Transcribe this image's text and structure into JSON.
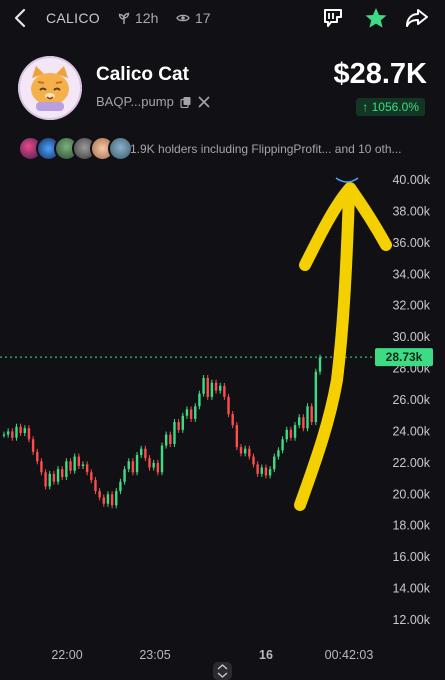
{
  "topbar": {
    "ticker": "CALICO",
    "age": "12h",
    "views": "17",
    "icons": [
      "back-chevron-icon",
      "sprout-icon",
      "eye-icon",
      "message-icon",
      "star-icon",
      "share-icon"
    ],
    "accent_star": "#3ddc84"
  },
  "token": {
    "name": "Calico Cat",
    "address": "BAQP...pump",
    "price": "$28.7K",
    "change": "↑ 1056.0%",
    "change_color": "#3ddc84"
  },
  "holders": {
    "text": "1.9K holders including FlippingProfit... and 10 oth..."
  },
  "chart_data": {
    "type": "line",
    "y_ticks": [
      "40.00k",
      "38.00k",
      "36.00k",
      "34.00k",
      "32.00k",
      "30.00k",
      "28.00k",
      "26.00k",
      "24.00k",
      "22.00k",
      "20.00k",
      "18.00k",
      "16.00k",
      "14.00k",
      "12.00k"
    ],
    "x_ticks": [
      "22:00",
      "23:05",
      "16",
      "00:42:03"
    ],
    "current_price_label": "28.73k",
    "current_price": 28.73,
    "ylim": [
      12,
      40
    ],
    "grid": false,
    "series": [
      {
        "values": [
          23.8,
          24.0,
          23.6,
          24.3,
          23.9,
          24.2,
          23.5,
          22.7,
          22.1,
          21.4,
          20.5,
          21.3,
          20.8,
          21.6,
          21.1,
          22.1,
          21.5,
          22.4,
          21.8,
          21.9,
          21.4,
          20.9,
          20.2,
          19.8,
          19.4,
          20.0,
          19.3,
          20.2,
          20.8,
          21.6,
          22.1,
          21.4,
          22.5,
          22.9,
          22.3,
          21.7,
          22.0,
          21.4,
          23.1,
          23.8,
          23.2,
          24.6,
          24.1,
          25.0,
          25.4,
          24.8,
          25.6,
          26.4,
          27.4,
          26.2,
          27.1,
          26.6,
          26.9,
          26.2,
          25.1,
          24.4,
          23.0,
          22.6,
          22.9,
          22.4,
          21.9,
          21.3,
          21.7,
          21.2,
          21.6,
          22.4,
          22.8,
          23.5,
          24.1,
          23.6,
          24.4,
          24.9,
          24.2,
          25.6,
          24.6,
          27.8,
          28.7
        ],
        "color": "#e8e8ea"
      }
    ]
  },
  "annotation": {
    "color": "#f5d000"
  },
  "scroll_handle_icon": "chevron-up-down-icon"
}
